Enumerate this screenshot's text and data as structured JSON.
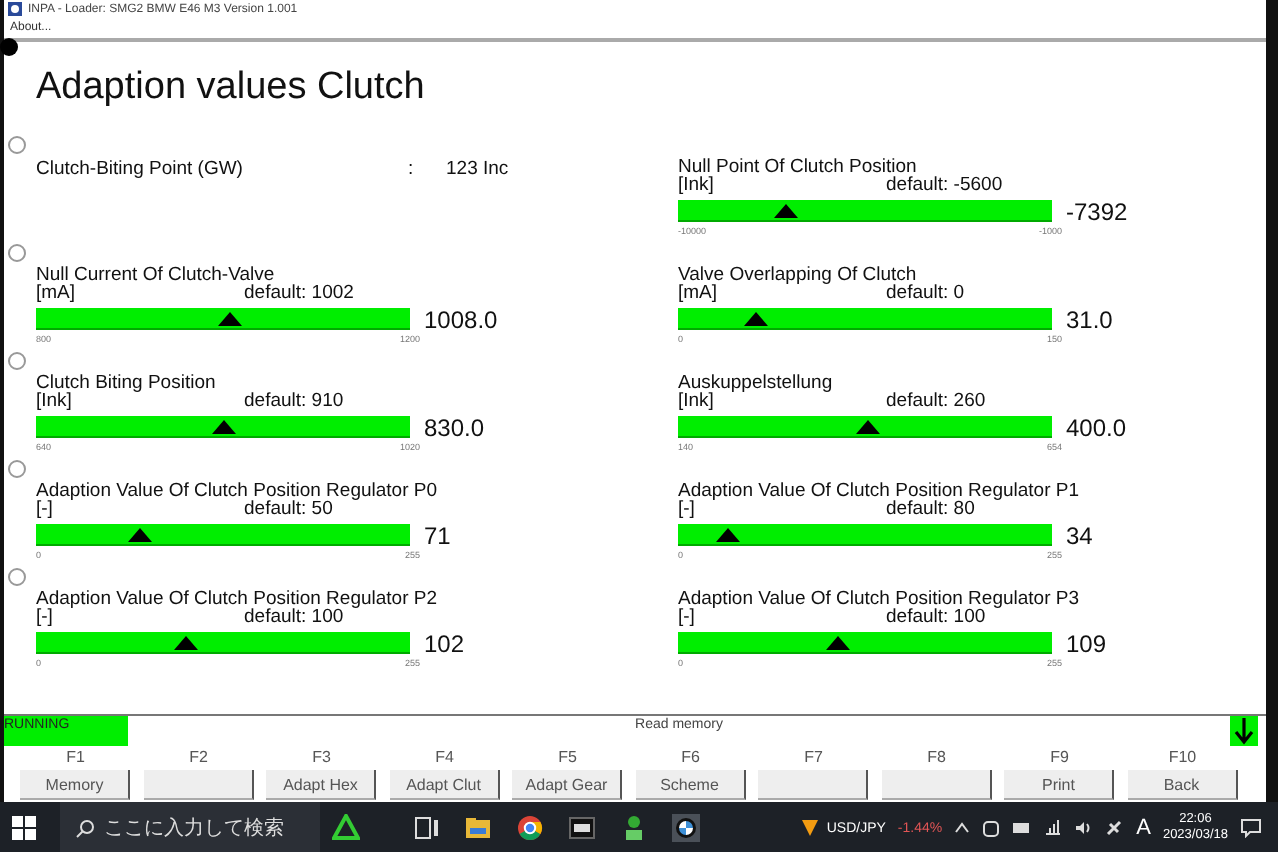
{
  "window": {
    "title": "INPA - Loader:  SMG2 BMW E46 M3 Version 1.001"
  },
  "menu": [
    "About..."
  ],
  "heading": "Adaption values Clutch",
  "rows": [
    {
      "selected": false,
      "items": [
        {
          "kind": "text",
          "label": "Clutch-Biting Point (GW)",
          "separator": ":",
          "value": "123 Inc"
        },
        {
          "kind": "gauge",
          "label": "Null Point Of Clutch Position",
          "unit": "[Ink]",
          "default": "default: -5600",
          "value": "-7392",
          "min": "-10000",
          "max": "-1000",
          "level": 0.29
        }
      ]
    },
    {
      "selected": false,
      "items": [
        {
          "kind": "gauge",
          "label": "Null Current Of Clutch-Valve",
          "unit": "[mA]",
          "default": "default: 1002",
          "value": "1008.0",
          "min": "800",
          "max": "1200",
          "level": 0.52
        },
        {
          "kind": "gauge",
          "label": "Valve Overlapping Of Clutch",
          "unit": "[mA]",
          "default": "default: 0",
          "value": "31.0",
          "min": "0",
          "max": "150",
          "level": 0.207
        }
      ]
    },
    {
      "selected": false,
      "items": [
        {
          "kind": "gauge",
          "label": "Clutch Biting Position",
          "unit": "[Ink]",
          "default": "default: 910",
          "value": "830.0",
          "min": "640",
          "max": "1020",
          "level": 0.5
        },
        {
          "kind": "gauge",
          "label": "Auskuppelstellung",
          "unit": "[Ink]",
          "default": "default: 260",
          "value": "400.0",
          "min": "140",
          "max": "654",
          "level": 0.506
        }
      ]
    },
    {
      "selected": false,
      "items": [
        {
          "kind": "gauge",
          "label": "Adaption Value Of Clutch Position Regulator P0",
          "unit": "[-]",
          "default": "default: 50",
          "value": "71",
          "min": "0",
          "max": "255",
          "level": 0.278
        },
        {
          "kind": "gauge",
          "label": "Adaption Value Of Clutch Position Regulator P1",
          "unit": "[-]",
          "default": "default: 80",
          "value": "34",
          "min": "0",
          "max": "255",
          "level": 0.133
        }
      ]
    },
    {
      "selected": false,
      "items": [
        {
          "kind": "gauge",
          "label": "Adaption Value Of Clutch Position Regulator P2",
          "unit": "[-]",
          "default": "default: 100",
          "value": "102",
          "min": "0",
          "max": "255",
          "level": 0.4
        },
        {
          "kind": "gauge",
          "label": "Adaption Value Of Clutch Position Regulator P3",
          "unit": "[-]",
          "default": "default: 100",
          "value": "109",
          "min": "0",
          "max": "255",
          "level": 0.427
        }
      ]
    }
  ],
  "status": {
    "state": "RUNNING",
    "message": "Read memory"
  },
  "function_keys": [
    {
      "key": "F1",
      "label": "Memory"
    },
    {
      "key": "F2"
    },
    {
      "key": "F3",
      "label": "Adapt Hex"
    },
    {
      "key": "F4",
      "label": "Adapt Clut"
    },
    {
      "key": "F5",
      "label": "Adapt Gear"
    },
    {
      "key": "F6",
      "label": "Scheme"
    },
    {
      "key": "F7"
    },
    {
      "key": "F8"
    },
    {
      "key": "F9",
      "label": "Print"
    },
    {
      "key": "F10",
      "label": "Back"
    }
  ],
  "taskbar": {
    "search_placeholder": "ここに入力して検索",
    "ticker_symbol": "USD/JPY",
    "ticker_change": "-1.44%",
    "ime": "A",
    "time": "22:06",
    "date": "2023/03/18"
  }
}
